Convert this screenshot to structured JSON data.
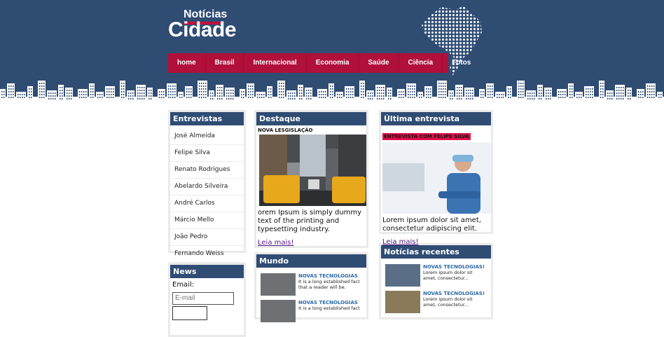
{
  "logo": {
    "small": "Notícias",
    "big": "Cidade"
  },
  "nav": [
    "home",
    "Brasil",
    "Internacional",
    "Economia",
    "Saúde",
    "Ciência",
    "Fotos"
  ],
  "entrevistas": {
    "title": "Entrevistas",
    "items": [
      "José Almeida",
      "Felipe Silva",
      "Renato Rodrigues",
      "Abelardo Silveira",
      "André Carlos",
      "Márcio Mello",
      "João Pedro",
      "Fernando Weiss"
    ]
  },
  "news_box": {
    "title": "News",
    "email_label": "Email:",
    "email_placeholder": "E-mail"
  },
  "destaque": {
    "title": "Destaque",
    "label": "NOVA LESGISLAÇÃO",
    "text": "orem Ipsum is simply dummy text of the printing and typesetting industry.",
    "link": "Leia mais!"
  },
  "mundo": {
    "title": "Mundo",
    "items": [
      {
        "title": "NOVAS TECNOLOGIAS",
        "text": "It is a long established fact that a reader will be."
      },
      {
        "title": "NOVAS TECNOLOGIAS",
        "text": "It is a long established fact"
      }
    ]
  },
  "ultima": {
    "title": "Última entrevista",
    "label": "ENTREVISTA COM FELIPE SILVA",
    "text": "Lorem ipsum dolor sit amet, consectetur adipiscing elit.",
    "link": "Leia mais!"
  },
  "recentes": {
    "title": "Notícias recentes",
    "items": [
      {
        "title": "NOVAS TECNOLOGIAS!",
        "text": "Lorem ipsum dolor sit amet, consectetur..."
      },
      {
        "title": "NOVAS TECNOLOGIAS!",
        "text": "Lorem ipsum dolor sit amet, consectetur..."
      }
    ]
  },
  "colors": {
    "navy": "#2f4c73",
    "crimson": "#b0103a",
    "label_pink": "#e0104a"
  },
  "icons": [
    "brazil-map-icon",
    "city-skyline-icon"
  ]
}
